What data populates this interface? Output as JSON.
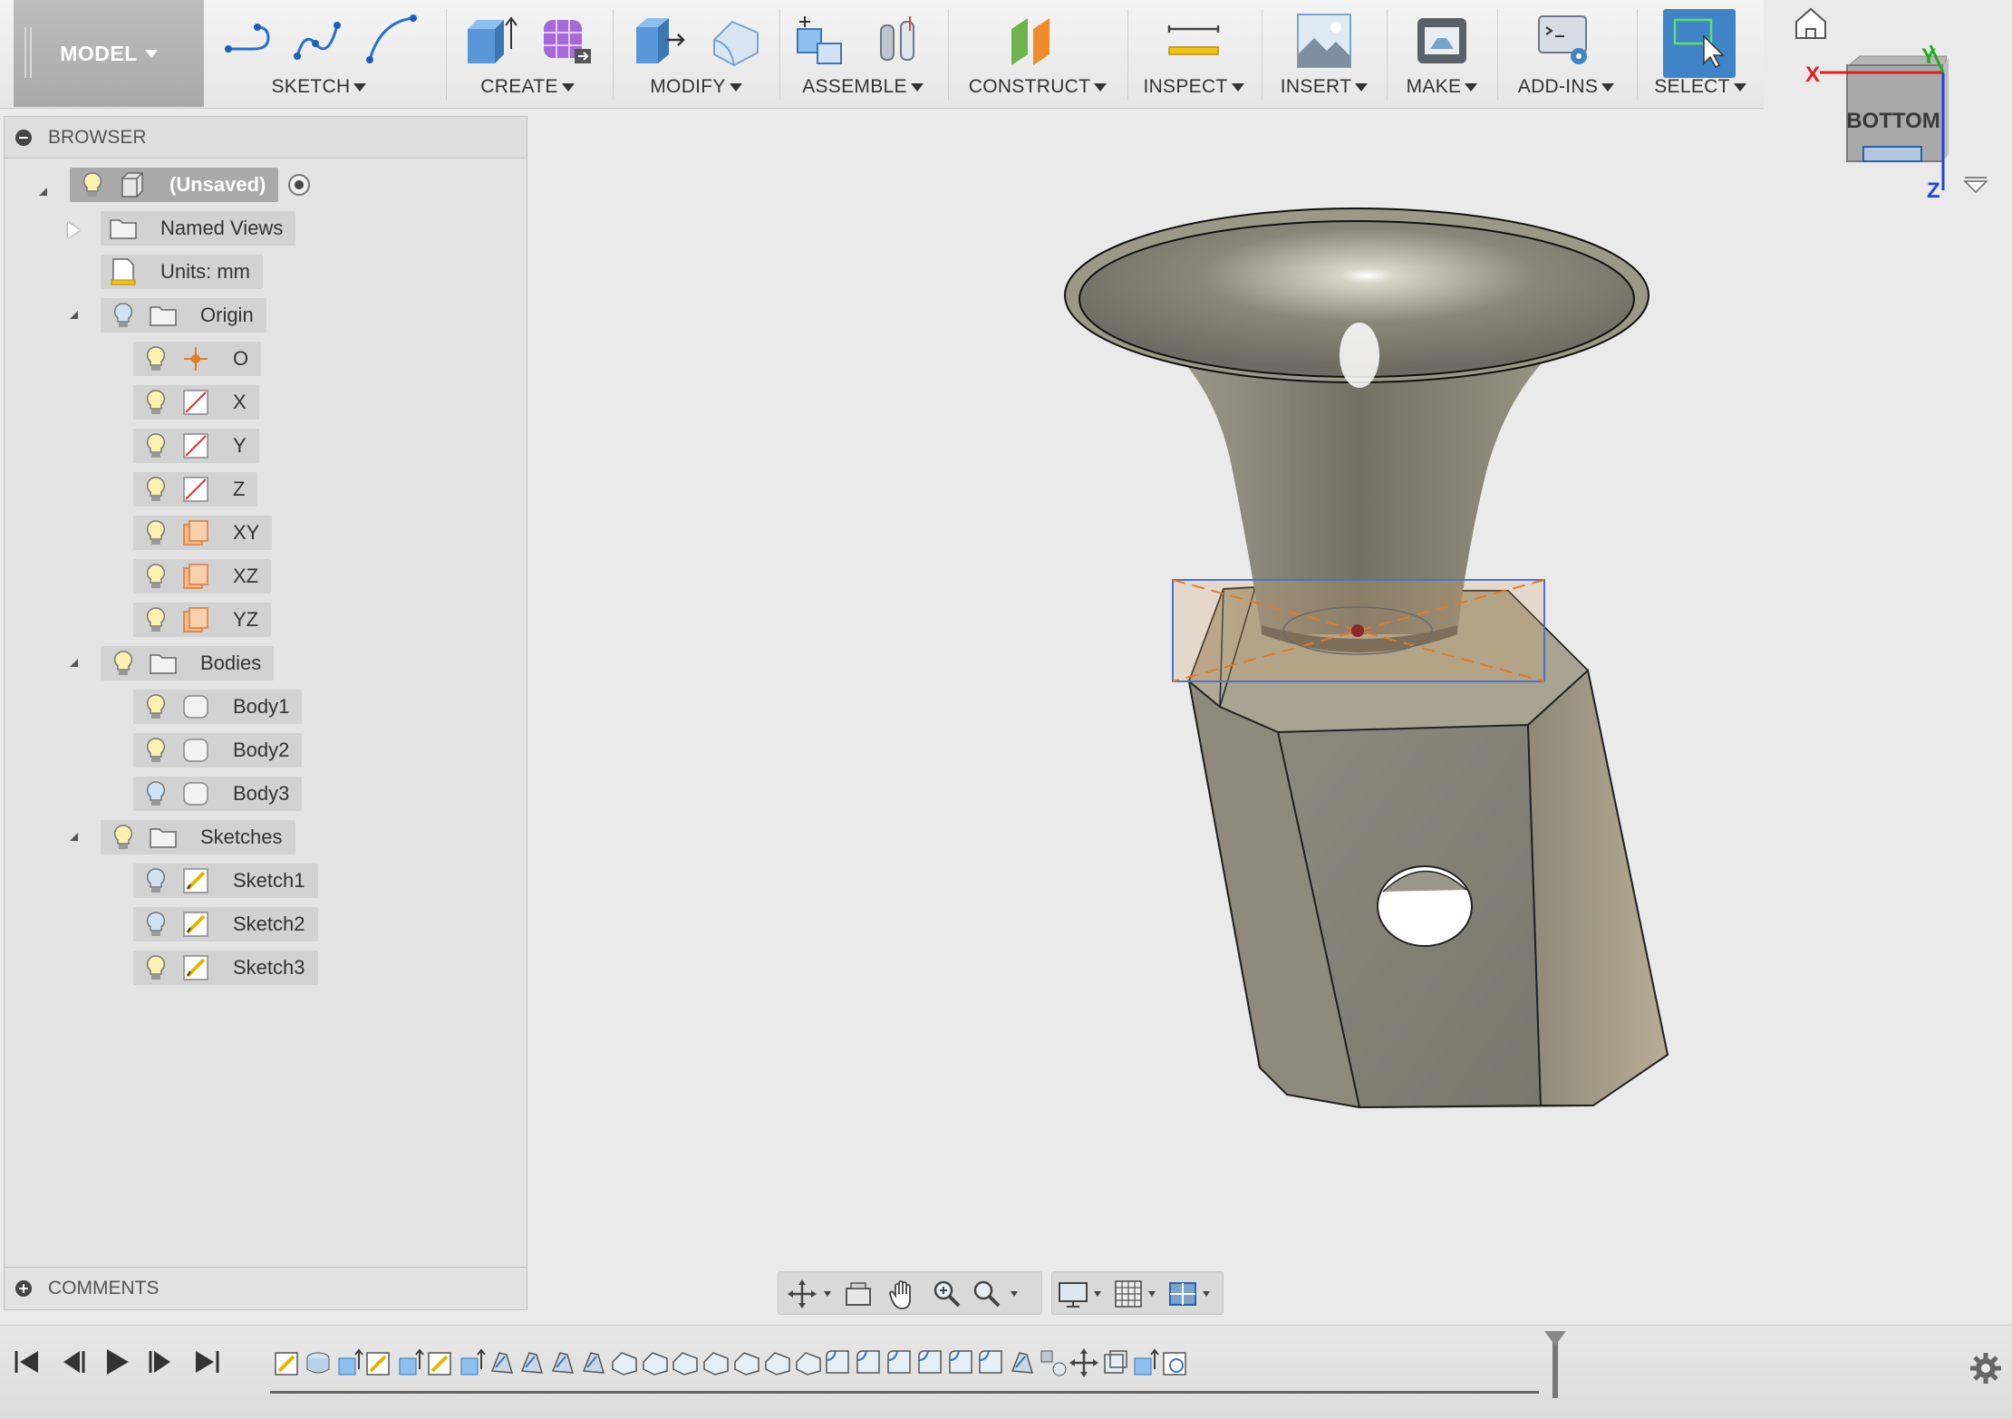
{
  "toolbar": {
    "workspace": "MODEL",
    "groups": [
      {
        "id": "sketch",
        "label": "SKETCH"
      },
      {
        "id": "create",
        "label": "CREATE"
      },
      {
        "id": "modify",
        "label": "MODIFY"
      },
      {
        "id": "assemble",
        "label": "ASSEMBLE"
      },
      {
        "id": "construct",
        "label": "CONSTRUCT"
      },
      {
        "id": "inspect",
        "label": "INSPECT"
      },
      {
        "id": "insert",
        "label": "INSERT"
      },
      {
        "id": "make",
        "label": "MAKE"
      },
      {
        "id": "addins",
        "label": "ADD-INS"
      },
      {
        "id": "select",
        "label": "SELECT"
      }
    ]
  },
  "viewcube": {
    "face": "BOTTOM",
    "axis_x": "X",
    "axis_y": "Y",
    "axis_z": "Z"
  },
  "browser": {
    "title": "BROWSER",
    "root": "(Unsaved)",
    "named_views": "Named Views",
    "units": "Units: mm",
    "origin": {
      "label": "Origin",
      "items": [
        "O",
        "X",
        "Y",
        "Z",
        "XY",
        "XZ",
        "YZ"
      ]
    },
    "bodies": {
      "label": "Bodies",
      "items": [
        "Body1",
        "Body2",
        "Body3"
      ]
    },
    "sketches": {
      "label": "Sketches",
      "items": [
        "Sketch1",
        "Sketch2",
        "Sketch3"
      ]
    }
  },
  "comments": {
    "title": "COMMENTS"
  },
  "colors": {
    "select_active": "#3f84c7",
    "model_gray": "#8b8878",
    "sketch_orange": "#e07b2a",
    "axis_x": "#e02020",
    "axis_y": "#22aa22",
    "axis_z": "#2244dd"
  },
  "timeline": {
    "controls": [
      "first-icon",
      "previous-icon",
      "play-icon",
      "next-icon",
      "last-icon"
    ]
  }
}
